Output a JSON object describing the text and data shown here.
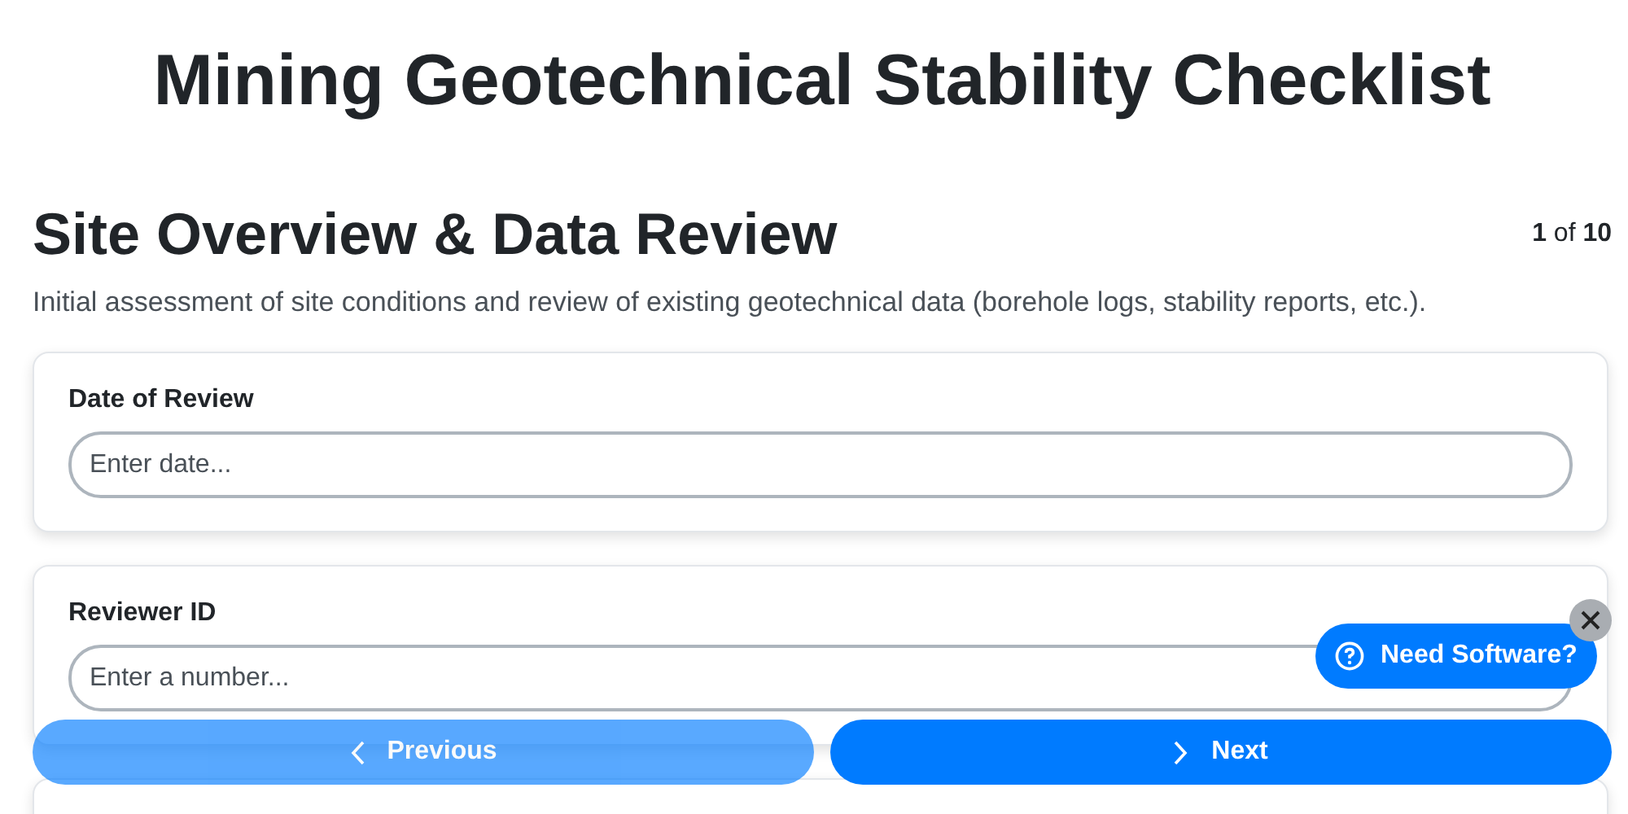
{
  "title": "Mining Geotechnical Stability Checklist",
  "section": {
    "heading": "Site Overview & Data Review",
    "counter": "**1** of **10**",
    "description": "Initial assessment of site conditions and review of existing geotechnical data (borehole logs, stability reports, etc.)."
  },
  "questions": [
    {
      "label": "Date of Review",
      "placeholder": "Enter date..."
    },
    {
      "label": "Reviewer ID",
      "placeholder": "Enter a number..."
    }
  ],
  "navigation": [
    {
      "kind": "previous",
      "label": "Previous",
      "disabled": true
    },
    {
      "kind": "next",
      "label": "Next",
      "disabled": false
    }
  ],
  "help_bubble": {
    "label": "Need Software?"
  }
}
